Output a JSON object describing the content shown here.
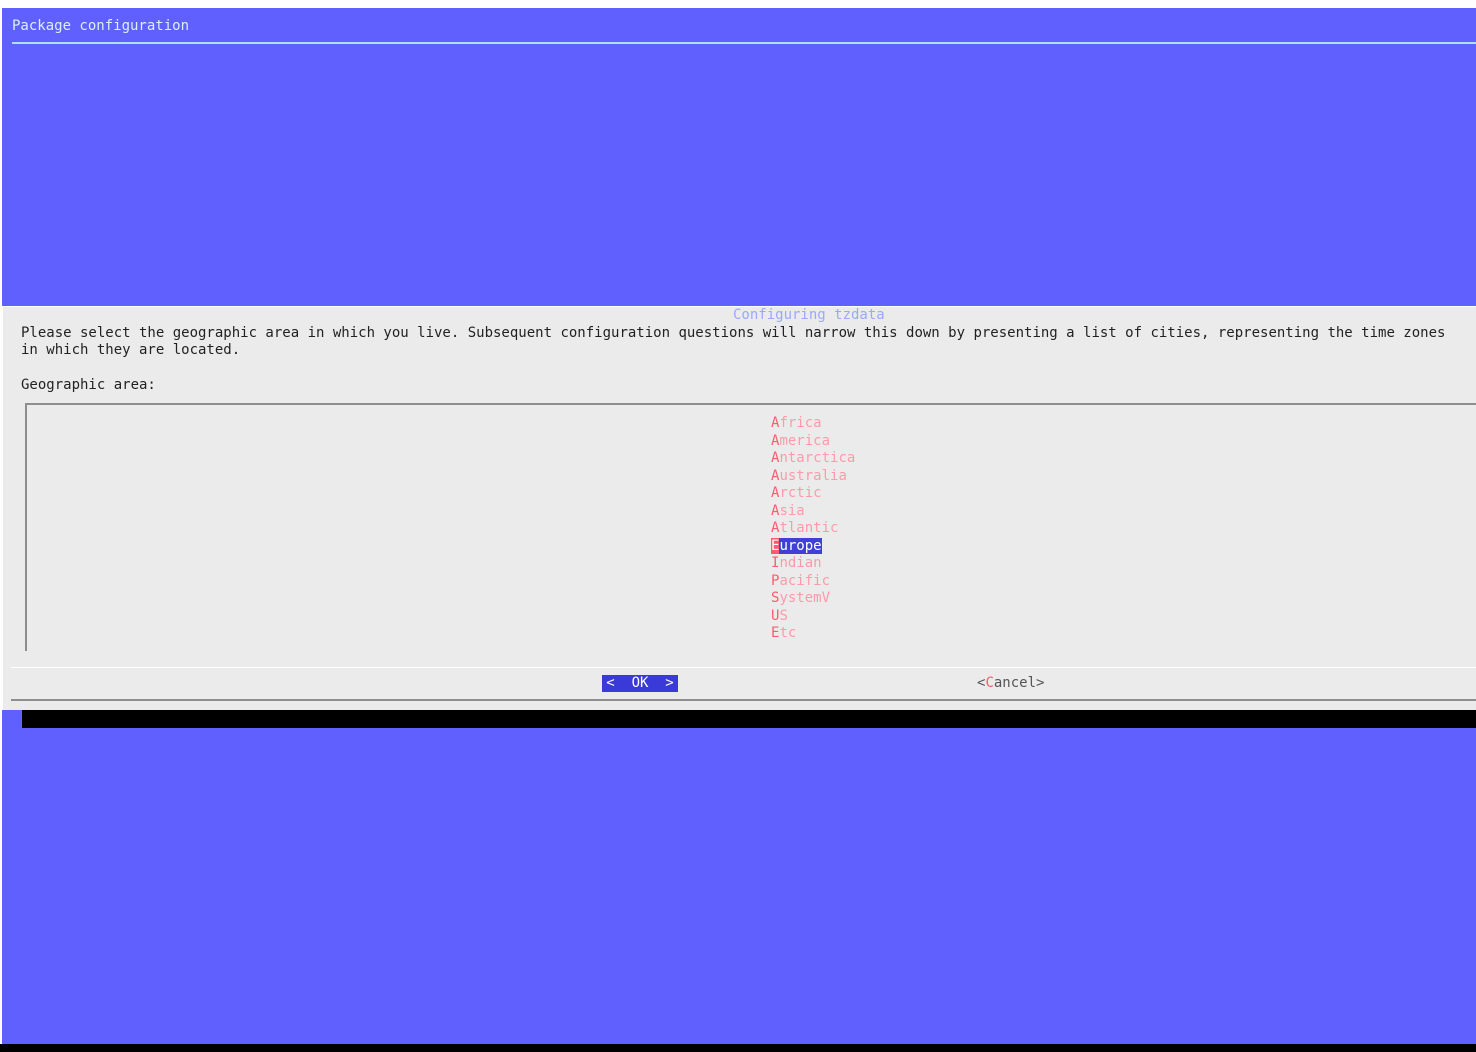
{
  "backtitle": "Package configuration",
  "dialog": {
    "title": "Configuring tzdata",
    "text": "Please select the geographic area in which you live. Subsequent configuration questions will narrow this down by presenting a list of cities, representing the time zones\nin which they are located.",
    "label": "Geographic area:",
    "items": [
      {
        "hot": "A",
        "rest": "frica"
      },
      {
        "hot": "A",
        "rest": "merica"
      },
      {
        "hot": "A",
        "rest": "ntarctica"
      },
      {
        "hot": "A",
        "rest": "ustralia"
      },
      {
        "hot": "A",
        "rest": "rctic"
      },
      {
        "hot": "A",
        "rest": "sia"
      },
      {
        "hot": "A",
        "rest": "tlantic"
      },
      {
        "hot": "E",
        "rest": "urope"
      },
      {
        "hot": "I",
        "rest": "ndian"
      },
      {
        "hot": "P",
        "rest": "acific"
      },
      {
        "hot": "S",
        "rest": "ystemV"
      },
      {
        "hot": "U",
        "rest": "S"
      },
      {
        "hot": "E",
        "rest": "tc"
      }
    ],
    "selected": "Europe",
    "ok_label": "<  OK  >",
    "cancel": {
      "open": "<",
      "hot": "C",
      "rest": "ancel",
      "close": ">"
    }
  },
  "colors": {
    "background": "#6060ff",
    "dialog": "#ebebeb",
    "shadow": "#000000",
    "highlight": "#4040d8",
    "hotkey": "#ff5a6e"
  }
}
